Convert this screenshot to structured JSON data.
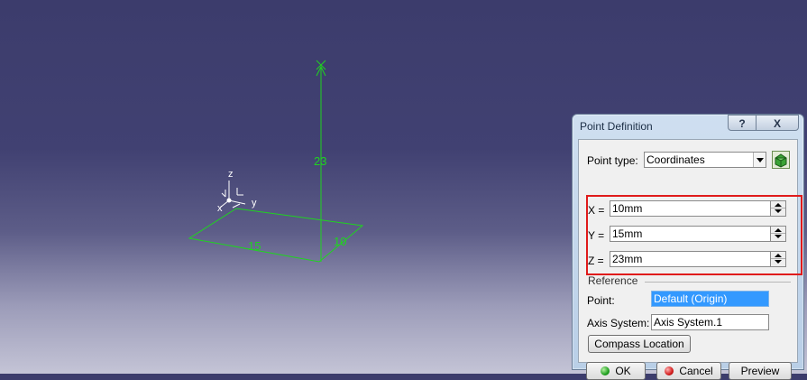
{
  "viewport": {
    "dimension_labels": {
      "height": "23",
      "x_length": "15",
      "y_length": "10"
    },
    "compass_axes": {
      "z": "z",
      "x": "x",
      "y": "y"
    },
    "sketch_color": "#1fd41f"
  },
  "dialog": {
    "title": "Point Definition",
    "help_label": "?",
    "close_label": "X",
    "point_type": {
      "label": "Point type:",
      "value": "Coordinates"
    },
    "coordinates": [
      {
        "label": "X =",
        "value": "10mm"
      },
      {
        "label": "Y =",
        "value": "15mm"
      },
      {
        "label": "Z =",
        "value": "23mm"
      }
    ],
    "reference": {
      "heading": "Reference",
      "point_label": "Point:",
      "point_value": "Default (Origin)",
      "axis_label": "Axis System:",
      "axis_value": "Axis System.1"
    },
    "compass_button": "Compass Location",
    "buttons": {
      "ok": "OK",
      "cancel": "Cancel",
      "preview": "Preview"
    },
    "highlight_color": "#e01b1b"
  }
}
